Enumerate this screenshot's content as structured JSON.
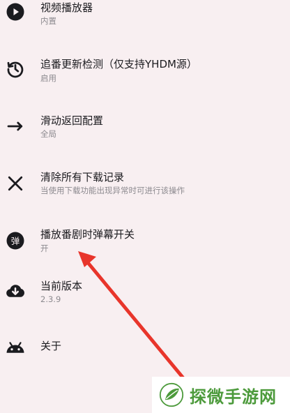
{
  "settings": {
    "items": [
      {
        "icon": "play-circle-icon",
        "title": "视频播放器",
        "subtitle": "内置"
      },
      {
        "icon": "update-clock-icon",
        "title": "追番更新检测（仅支持YHDM源）",
        "subtitle": "启用"
      },
      {
        "icon": "arrow-right-icon",
        "title": "滑动返回配置",
        "subtitle": "全局"
      },
      {
        "icon": "close-icon",
        "title": "清除所有下载记录",
        "subtitle": "当使用下载功能出现异常时可进行该操作"
      },
      {
        "icon": "danmaku-icon",
        "icon_glyph": "弹",
        "title": "播放番剧时弹幕开关",
        "subtitle": "开"
      },
      {
        "icon": "cloud-download-icon",
        "title": "当前版本",
        "subtitle": "2.3.9"
      },
      {
        "icon": "android-icon",
        "title": "关于",
        "subtitle": ""
      }
    ]
  },
  "annotation": {
    "color": "#e8352b"
  },
  "watermark": {
    "text": "探微手游网",
    "color": "#4c9a3b"
  }
}
